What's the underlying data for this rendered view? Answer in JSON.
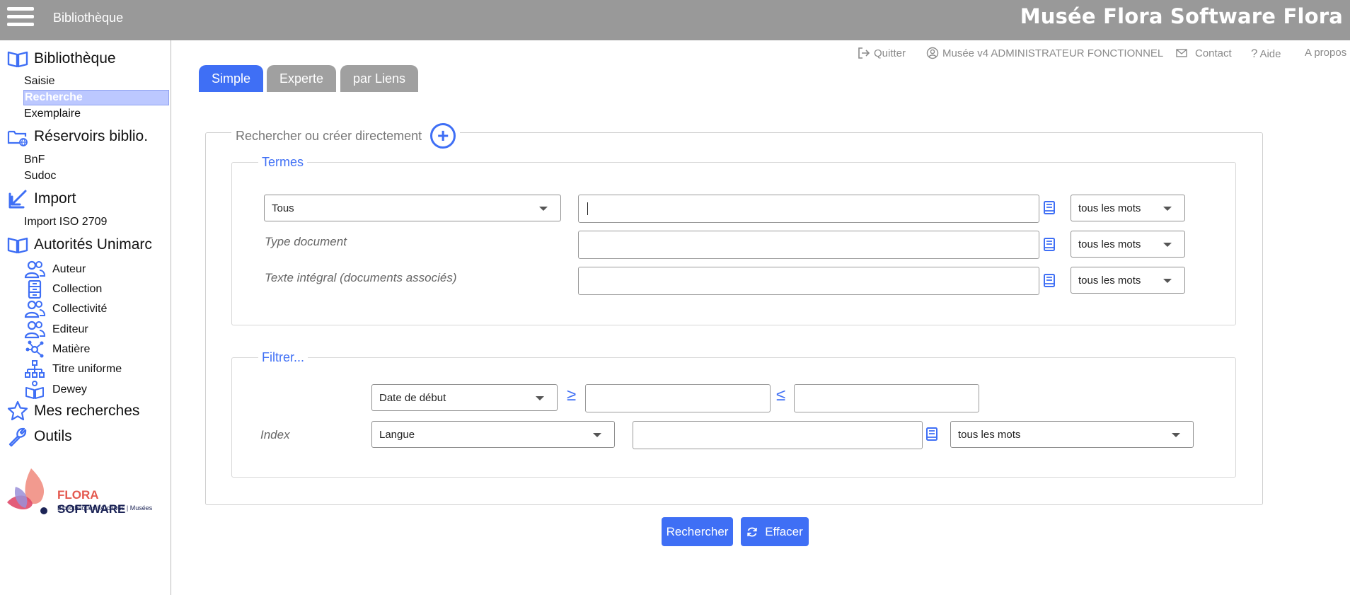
{
  "header": {
    "menu_icon": "hamburger-icon",
    "title": "Bibliothèque",
    "brand": "Musée Flora Software Flora"
  },
  "sidebar": {
    "sections": {
      "bibliotheque": {
        "label": "Bibliothèque",
        "icon": "open-book-icon",
        "items": [
          "Saisie",
          "Recherche",
          "Exemplaire"
        ],
        "active": "Recherche"
      },
      "reservoirs": {
        "label": "Réservoirs biblio.",
        "icon": "globe-folder-icon",
        "items": [
          "BnF",
          "Sudoc"
        ]
      },
      "import": {
        "label": "Import",
        "icon": "import-arrow-icon",
        "items": [
          "Import ISO 2709"
        ]
      },
      "autorites": {
        "label": "Autorités Unimarc",
        "icon": "open-book-icon",
        "items": [
          {
            "label": "Auteur",
            "icon": "users-icon"
          },
          {
            "label": "Collection",
            "icon": "cabinet-icon"
          },
          {
            "label": "Collectivité",
            "icon": "users-icon"
          },
          {
            "label": "Editeur",
            "icon": "users-icon"
          },
          {
            "label": "Matière",
            "icon": "network-icon"
          },
          {
            "label": "Titre uniforme",
            "icon": "hierarchy-icon"
          },
          {
            "label": "Dewey",
            "icon": "reading-person-icon"
          }
        ]
      },
      "mes_recherches": {
        "label": "Mes recherches",
        "icon": "star-icon"
      },
      "outils": {
        "label": "Outils",
        "icon": "wrench-icon"
      }
    },
    "logo": {
      "brand_a": "FLORA",
      "brand_b": "SOFTWARE",
      "tagline": "Bibliothèques | Archives | Musées"
    }
  },
  "top_menu": {
    "quit": "Quitter",
    "user": "Musée v4 ADMINISTRATEUR FONCTIONNEL",
    "contact": "Contact",
    "help": "Aide",
    "about": "A propos"
  },
  "tabs": [
    "Simple",
    "Experte",
    "par Liens"
  ],
  "active_tab": "Simple",
  "search": {
    "legend": "Rechercher ou créer directement",
    "termes": {
      "legend": "Termes",
      "rows": [
        {
          "field": "Tous",
          "value": "",
          "mode": "tous les mots"
        },
        {
          "field": "Type document",
          "value": "",
          "mode": "tous les mots"
        },
        {
          "field": "Texte intégral (documents associés)",
          "value": "",
          "mode": "tous les mots"
        }
      ]
    },
    "filtrer": {
      "legend": "Filtrer...",
      "date_select": "Date de début",
      "ge": "≥",
      "le": "≤",
      "date_from": "",
      "date_to": "",
      "index_label": "Index",
      "index_select": "Langue",
      "index_value": "",
      "index_mode": "tous les mots"
    }
  },
  "buttons": {
    "search": "Rechercher",
    "clear": "Effacer"
  },
  "colors": {
    "accent": "#3f6ff5",
    "topbar": "#999999",
    "active_item": "#bcc8ff"
  }
}
